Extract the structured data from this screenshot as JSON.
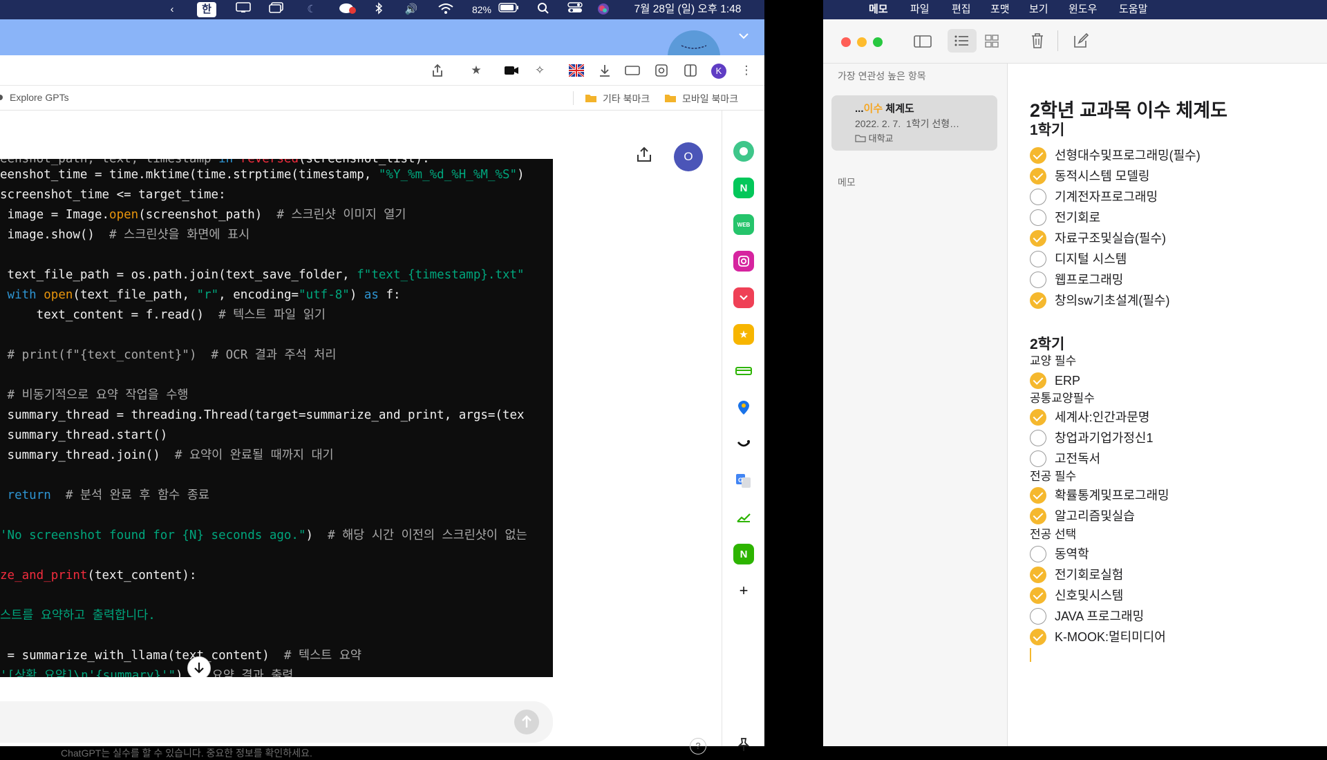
{
  "menubar": {
    "input_mode": "한",
    "battery": "82%",
    "clock": "7월 28일 (일) 오후 1:48"
  },
  "browser": {
    "bookmark_explore": "Explore GPTs",
    "bookmark_folder_other": "기타 북마크",
    "bookmark_folder_mobile": "모바일 북마크",
    "profile_initial": "K",
    "user_avatar_initial": "O",
    "disclaimer": "ChatGPT는 실수를 할 수 있습니다. 중요한 정보를 확인하세요.",
    "help_label": "?"
  },
  "code": {
    "lines": [
      "eenshot_path, text, timestamp in reversed(screenshot_list):",
      "eenshot_time = time.mktime(time.strptime(timestamp, \"%Y_%m_%d_%H_%M_%S\"",
      "screenshot_time <= target_time:",
      " image = Image.open(screenshot_path)  # 스크린샷 이미지 열기",
      " image.show()  # 스크린샷을 화면에 표시",
      "",
      " text_file_path = os.path.join(text_save_folder, f\"text_{timestamp}.txt\"",
      " with open(text_file_path, \"r\", encoding=\"utf-8\") as f:",
      "     text_content = f.read()  # 텍스트 파일 읽기",
      "",
      " # print(f\"{text_content}\")  # OCR 결과 주석 처리",
      "",
      " # 비동기적으로 요약 작업을 수행",
      " summary_thread = threading.Thread(target=summarize_and_print, args=(tex",
      " summary_thread.start()",
      " summary_thread.join()  # 요약이 완료될 때까지 대기",
      "",
      " return  # 분석 완료 후 함수 종료",
      "",
      "'No screenshot found for {N} seconds ago.\")  # 해당 시간 이전의 스크린샷이 없는",
      "",
      "ze_and_print(text_content):",
      "",
      "스트를 요약하고 출력합니다.",
      "",
      " = summarize_with_llama(text_content)  # 텍스트 요약",
      "'[상황 요약]\\n'{summary}'\")  # 요약 결과 출력"
    ]
  },
  "notes_menubar": {
    "items": [
      "메모",
      "파일",
      "편집",
      "포맷",
      "보기",
      "윈도우",
      "도움말"
    ]
  },
  "notes_list": {
    "header": "가장 연관성 높은 항목",
    "card_title_prefix": "...",
    "card_title_highlight": "이수",
    "card_title_rest": " 체계도",
    "card_date": "2022. 2. 7.",
    "card_preview": "1학기 선형…",
    "card_folder": "대학교",
    "section2": "메모"
  },
  "note": {
    "title": "2학년 교과목 이수 체계도",
    "sem1": "1학기",
    "sem1_items": [
      {
        "text": "선형대수및프로그래밍(필수)",
        "checked": true
      },
      {
        "text": "동적시스템 모델링",
        "checked": true
      },
      {
        "text": "기계전자프로그래밍",
        "checked": false
      },
      {
        "text": "전기회로",
        "checked": false
      },
      {
        "text": "자료구조및실습(필수)",
        "checked": true
      },
      {
        "text": "디지털 시스템",
        "checked": false
      },
      {
        "text": "웹프로그래밍",
        "checked": false
      },
      {
        "text": "창의sw기초설계(필수)",
        "checked": true
      }
    ],
    "sem2": "2학기",
    "grp_liberal_req": "교양 필수",
    "grp_liberal_req_items": [
      {
        "text": "ERP",
        "checked": true
      }
    ],
    "grp_common": "공통교양필수",
    "grp_common_items": [
      {
        "text": "세계사:인간과문명",
        "checked": true
      },
      {
        "text": "창업과기업가정신1",
        "checked": false
      },
      {
        "text": "고전독서",
        "checked": false
      }
    ],
    "grp_major_req": "전공 필수",
    "grp_major_req_items": [
      {
        "text": "확률통계및프로그래밍",
        "checked": true
      },
      {
        "text": "알고리즘및실습",
        "checked": true
      }
    ],
    "grp_major_elec": "전공 선택",
    "grp_major_elec_items": [
      {
        "text": "동역학",
        "checked": false
      },
      {
        "text": "전기회로실험",
        "checked": true
      },
      {
        "text": "신호및시스템",
        "checked": true
      },
      {
        "text": "JAVA 프로그래밍",
        "checked": false
      },
      {
        "text": "K-MOOK:멀티미디어",
        "checked": true
      }
    ]
  },
  "colors": {
    "checkbox_on": "#f5b82e",
    "menubar": "#1f2c5c",
    "tabstrip": "#8ab4f8",
    "highlight": "#f5a623"
  }
}
